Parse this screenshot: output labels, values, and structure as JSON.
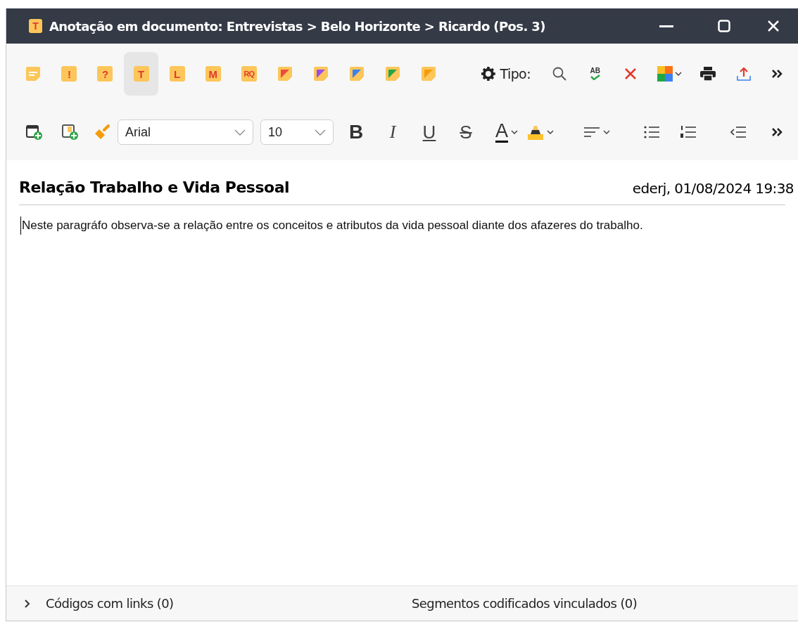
{
  "window": {
    "title": "Anotação em documento: Entrevistas > Belo Horizonte > Ricardo (Pos. 3)",
    "icon_letter": "T"
  },
  "memo_types": [
    {
      "kind": "lines",
      "selected": false
    },
    {
      "kind": "letter",
      "letter": "!",
      "selected": false
    },
    {
      "kind": "letter",
      "letter": "?",
      "selected": false
    },
    {
      "kind": "letter",
      "letter": "T",
      "selected": true
    },
    {
      "kind": "letter",
      "letter": "L",
      "selected": false
    },
    {
      "kind": "letter",
      "letter": "M",
      "selected": false
    },
    {
      "kind": "letter",
      "letter": "RQ",
      "selected": false
    },
    {
      "kind": "corner",
      "color": "#e84c3d",
      "selected": false
    },
    {
      "kind": "corner",
      "color": "#9b4de8",
      "selected": false
    },
    {
      "kind": "corner",
      "color": "#3b82f0",
      "selected": false
    },
    {
      "kind": "corner",
      "color": "#22a646",
      "selected": false
    },
    {
      "kind": "corner",
      "color": "#f59b0b",
      "selected": false
    }
  ],
  "type_label": "Tipo:",
  "spell_check_text": "AB",
  "font_field": {
    "value": "Arial"
  },
  "size_field": {
    "value": "10"
  },
  "format_buttons": [
    {
      "kind": "bold",
      "label": "B"
    },
    {
      "kind": "italic",
      "label": "I"
    },
    {
      "kind": "underline",
      "label": "U"
    },
    {
      "kind": "strike",
      "label": "S"
    }
  ],
  "font_color_letter": "A",
  "memo": {
    "title": "Relação Trabalho e Vida Pessoal",
    "meta": "ederj, 01/08/2024 19:38",
    "body": "Neste paragráfo observa-se a relação entre os conceitos e atributos da vida pessoal diante dos afazeres do trabalho."
  },
  "footer": {
    "expanded": false,
    "codes": "Códigos com links (0)",
    "segments": "Segmentos codificados vinculados (0)"
  }
}
